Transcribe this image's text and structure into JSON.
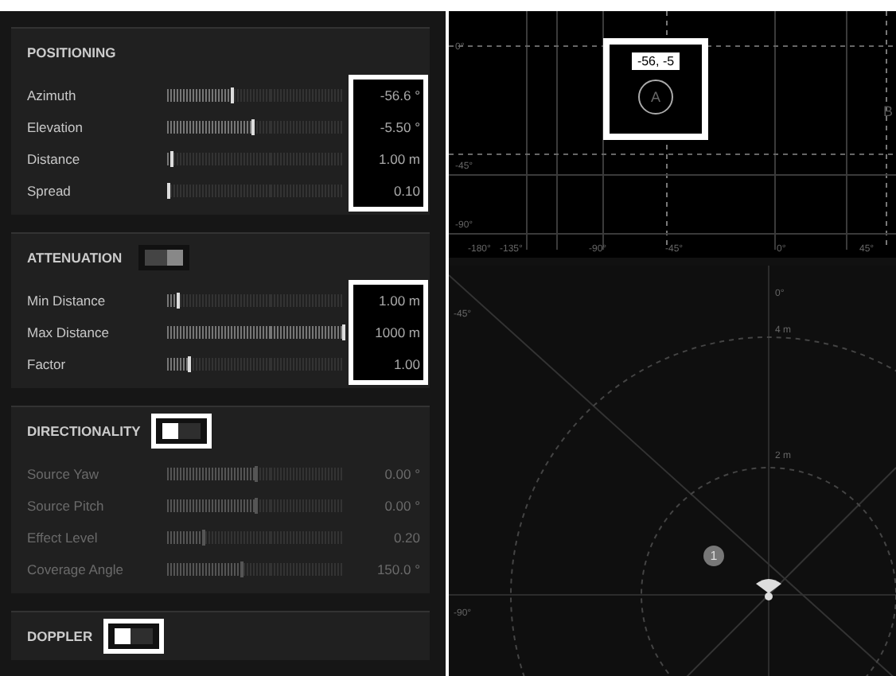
{
  "sections": [
    {
      "title": "POSITIONING",
      "values_highlighted": true,
      "rows": [
        {
          "label": "Azimuth",
          "level": 0.36,
          "reading": "-56.6 °"
        },
        {
          "label": "Elevation",
          "level": 0.48,
          "reading": "-5.50 °"
        },
        {
          "label": "Distance",
          "level": 0.02,
          "reading": "1.00 m"
        },
        {
          "label": "Spread",
          "level": 0.0,
          "reading": "0.10"
        }
      ]
    },
    {
      "title": "ATTENUATION",
      "toggle": {
        "on": true
      },
      "values_highlighted": true,
      "rows": [
        {
          "label": "Min Distance",
          "level": 0.05,
          "reading": "1.00 m"
        },
        {
          "label": "Max Distance",
          "level": 1.0,
          "reading": "1000 m"
        },
        {
          "label": "Factor",
          "level": 0.12,
          "reading": "1.00"
        }
      ]
    },
    {
      "title": "DIRECTIONALITY",
      "toggle": {
        "on": false,
        "highlighted": true
      },
      "rows": [
        {
          "label": "Source Yaw",
          "level": 0.5,
          "reading": "0.00 °"
        },
        {
          "label": "Source Pitch",
          "level": 0.5,
          "reading": "0.00 °"
        },
        {
          "label": "Effect Level",
          "level": 0.2,
          "reading": "0.20"
        },
        {
          "label": "Coverage Angle",
          "level": 0.42,
          "reading": "150.0 °"
        }
      ]
    },
    {
      "title": "DOPPLER",
      "toggle": {
        "on": false,
        "highlighted": true
      }
    }
  ],
  "panorama": {
    "y_labels": [
      "0°",
      "-45°",
      "-90°"
    ],
    "x_labels": [
      "-180°",
      "-135°",
      "-90°",
      "-45°",
      "0°",
      "45°"
    ],
    "markers": [
      {
        "label": "A",
        "tooltip": "-56, -5",
        "highlighted": true
      },
      {
        "label": "B"
      }
    ]
  },
  "radar": {
    "angle_labels": [
      "0°",
      "-45°",
      "-90°"
    ],
    "ring_labels": [
      "4 m",
      "2 m"
    ],
    "source_badge": "1"
  }
}
